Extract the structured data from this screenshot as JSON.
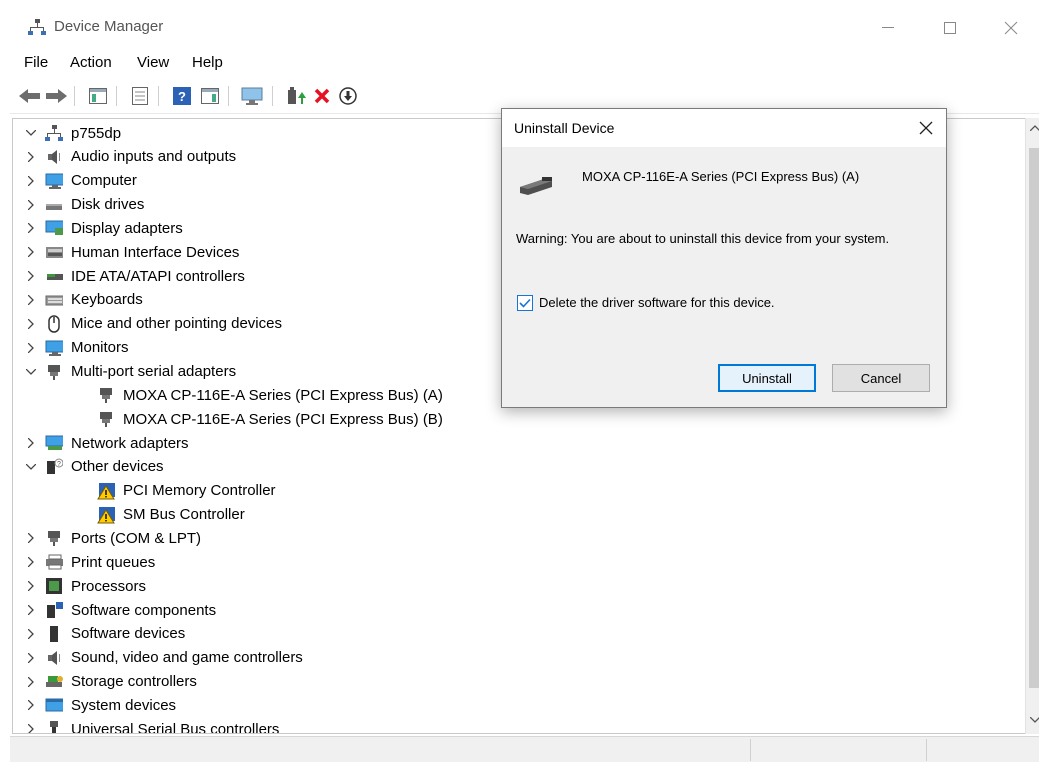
{
  "window": {
    "title": "Device Manager"
  },
  "menu": [
    "File",
    "Action",
    "View",
    "Help"
  ],
  "toolbar": {
    "buttons": [
      "back-icon",
      "forward-icon",
      "show-hide-console-tree-icon",
      "properties-icon",
      "help-icon",
      "action-pane-icon",
      "monitor-icon",
      "update-driver-icon",
      "uninstall-icon",
      "disable-device-icon"
    ]
  },
  "tree": {
    "root": "p755dp",
    "items": [
      {
        "label": "Audio inputs and outputs",
        "expanded": false,
        "icon": "speaker-icon"
      },
      {
        "label": "Computer",
        "expanded": false,
        "icon": "computer-icon"
      },
      {
        "label": "Disk drives",
        "expanded": false,
        "icon": "disk-drive-icon"
      },
      {
        "label": "Display adapters",
        "expanded": false,
        "icon": "display-adapter-icon"
      },
      {
        "label": "Human Interface Devices",
        "expanded": false,
        "icon": "hid-icon"
      },
      {
        "label": "IDE ATA/ATAPI controllers",
        "expanded": false,
        "icon": "ide-controller-icon"
      },
      {
        "label": "Keyboards",
        "expanded": false,
        "icon": "keyboard-icon"
      },
      {
        "label": "Mice and other pointing devices",
        "expanded": false,
        "icon": "mouse-icon"
      },
      {
        "label": "Monitors",
        "expanded": false,
        "icon": "monitor-icon"
      },
      {
        "label": "Multi-port serial adapters",
        "expanded": true,
        "icon": "serial-port-icon"
      },
      {
        "label": "MOXA CP-116E-A Series (PCI Express Bus) (A)",
        "child": true,
        "icon": "serial-port-icon"
      },
      {
        "label": "MOXA CP-116E-A Series (PCI Express Bus) (B)",
        "child": true,
        "icon": "serial-port-icon"
      },
      {
        "label": "Network adapters",
        "expanded": false,
        "icon": "network-adapter-icon"
      },
      {
        "label": "Other devices",
        "expanded": true,
        "icon": "unknown-device-icon"
      },
      {
        "label": "PCI Memory Controller",
        "child": true,
        "icon": "warning-device-icon"
      },
      {
        "label": "SM Bus Controller",
        "child": true,
        "icon": "warning-device-icon"
      },
      {
        "label": "Ports (COM & LPT)",
        "expanded": false,
        "icon": "port-icon"
      },
      {
        "label": "Print queues",
        "expanded": false,
        "icon": "printer-icon"
      },
      {
        "label": "Processors",
        "expanded": false,
        "icon": "processor-icon"
      },
      {
        "label": "Software components",
        "expanded": false,
        "icon": "software-component-icon"
      },
      {
        "label": "Software devices",
        "expanded": false,
        "icon": "software-device-icon"
      },
      {
        "label": "Sound, video and game controllers",
        "expanded": false,
        "icon": "speaker-icon"
      },
      {
        "label": "Storage controllers",
        "expanded": false,
        "icon": "storage-controller-icon"
      },
      {
        "label": "System devices",
        "expanded": false,
        "icon": "system-device-icon"
      },
      {
        "label": "Universal Serial Bus controllers",
        "expanded": false,
        "icon": "usb-icon"
      }
    ]
  },
  "dialog": {
    "title": "Uninstall Device",
    "device_name": "MOXA CP-116E-A Series (PCI Express Bus) (A)",
    "warning": "Warning: You are about to uninstall this device from your system.",
    "checkbox_label": "Delete the driver software for this device.",
    "checkbox_checked": true,
    "uninstall_label": "Uninstall",
    "cancel_label": "Cancel"
  },
  "colors": {
    "accent": "#0078d7",
    "uninstall_red": "#e81123",
    "update_green": "#2e9e3e"
  }
}
